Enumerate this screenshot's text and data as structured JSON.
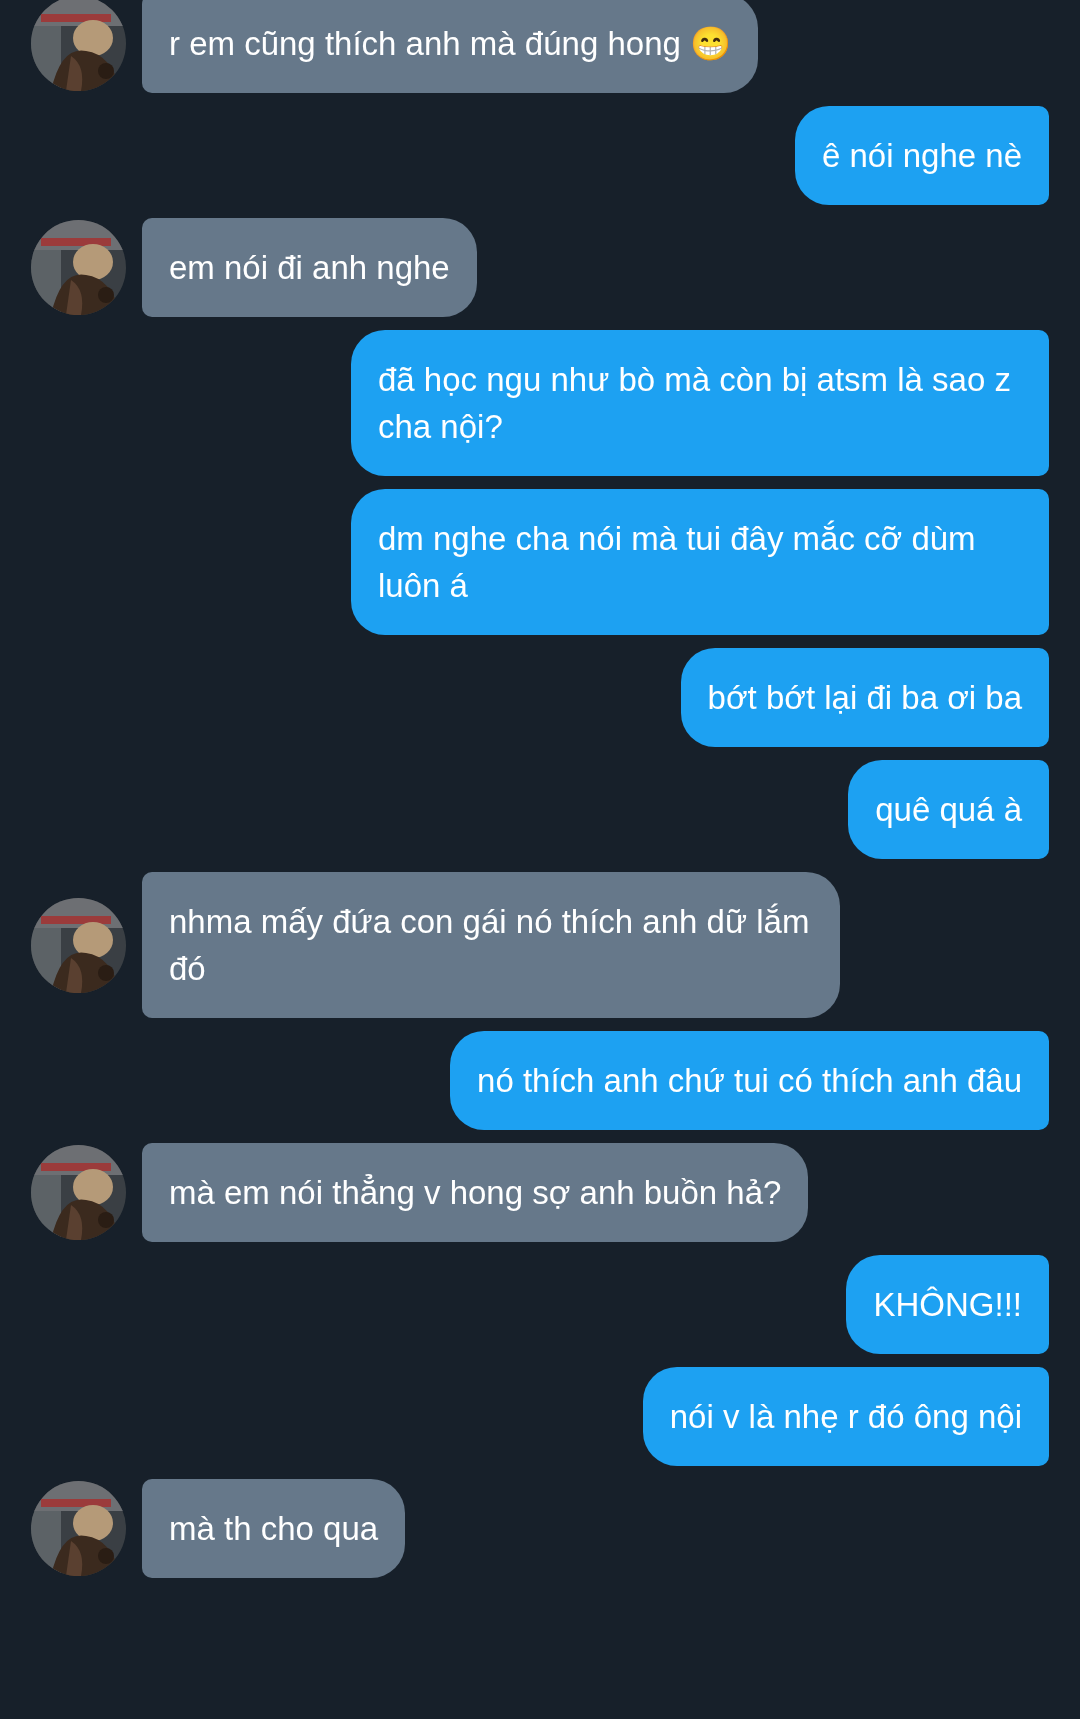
{
  "messages": [
    {
      "kind": "incoming",
      "text": "r em cũng thích anh mà đúng hong 😁"
    },
    {
      "kind": "outgoing",
      "text": "ê nói nghe nè"
    },
    {
      "kind": "incoming",
      "text": "em nói đi anh nghe"
    },
    {
      "kind": "outgoing",
      "text": "đã học ngu như bò mà còn bị atsm là sao z cha nội?"
    },
    {
      "kind": "outgoing",
      "text": "dm nghe cha nói mà tui đây mắc cỡ dùm luôn á"
    },
    {
      "kind": "outgoing",
      "text": "bớt bớt lại đi ba ơi ba"
    },
    {
      "kind": "outgoing",
      "text": "quê quá à"
    },
    {
      "kind": "incoming",
      "text": "nhma mấy đứa con gái nó thích anh dữ lắm đó"
    },
    {
      "kind": "outgoing",
      "text": "nó thích anh chứ tui có thích anh đâu"
    },
    {
      "kind": "incoming",
      "text": "mà em nói thẳng v hong sợ anh buồn hả?"
    },
    {
      "kind": "outgoing",
      "text": "KHÔNG!!!"
    },
    {
      "kind": "outgoing",
      "text": "nói v là nhẹ r đó ông nội"
    },
    {
      "kind": "incoming",
      "text": "mà th cho qua"
    }
  ]
}
